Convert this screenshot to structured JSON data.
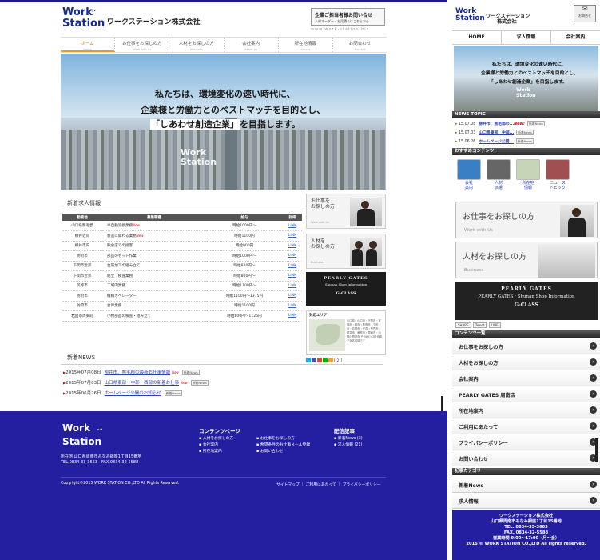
{
  "desktop": {
    "logo": {
      "line1": "Work",
      "line2": "Station"
    },
    "company_name": "ワークステーション株式会社",
    "contact": {
      "title": "企業ご担当者様お問い合せ",
      "sub": "人材オーダー・お見積りはこちらから"
    },
    "url": "www.work-station.biz",
    "nav": [
      {
        "label": "ホーム",
        "en": "Home"
      },
      {
        "label": "お仕事をお探しの方",
        "en": "Work with Us"
      },
      {
        "label": "人材をお探しの方",
        "en": "Business"
      },
      {
        "label": "会社案内",
        "en": "About Us"
      },
      {
        "label": "所在地情報",
        "en": "Access"
      },
      {
        "label": "お問合わせ",
        "en": "Contact"
      }
    ],
    "hero": {
      "line1": "私たちは、環境変化の速い時代に、",
      "line2": "企業様と労働力とのベストマッチを目的とし、",
      "line3_quote": "「しあわせ創造企業」",
      "line3_rest": "を目指します。",
      "watermark1": "Work",
      "watermark2": "Station"
    },
    "jobs": {
      "title": "新着求人情報",
      "headers": [
        "勤務地",
        "募集職種",
        "給与",
        "詳細"
      ],
      "rows": [
        {
          "place": "山口県熊毛郡",
          "type": "半自動溶接業務",
          "new": "New",
          "pay": "時給1000円〜",
          "link": "LINK"
        },
        {
          "place": "柳井近郊",
          "type": "製造に関わる業務",
          "new": "New",
          "pay": "時給1100円",
          "link": "LINK"
        },
        {
          "place": "柳井市内",
          "type": "飲食店での接客",
          "new": "",
          "pay": "時給900円",
          "link": "LINK"
        },
        {
          "place": "防府市",
          "type": "部品のセット作業",
          "new": "",
          "pay": "時給1000円〜",
          "link": "LINK"
        },
        {
          "place": "下関市近郊",
          "type": "金属加工の組み立て",
          "new": "",
          "pay": "時給820円〜",
          "link": "LINK"
        },
        {
          "place": "下関市近郊",
          "type": "組立　検査業務",
          "new": "",
          "pay": "時給800円〜",
          "link": "LINK"
        },
        {
          "place": "美祢市",
          "type": "工場内業務",
          "new": "",
          "pay": "時給1100円〜",
          "link": "LINK"
        },
        {
          "place": "防府市",
          "type": "機械オペレーター",
          "new": "",
          "pay": "時給1100円〜1375円",
          "link": "LINK"
        },
        {
          "place": "防府市",
          "type": "倉庫業務",
          "new": "",
          "pay": "時給1100円",
          "link": "LINK"
        },
        {
          "place": "岩国市周東町",
          "type": "小物部品の検査・組み立て",
          "new": "",
          "pay": "時給800円〜1125円",
          "link": "LINK"
        }
      ]
    },
    "side": {
      "work": {
        "line1": "お仕事を",
        "line2": "お探しの方",
        "en": "Work with Us"
      },
      "business": {
        "line1": "人材を",
        "line2": "お探しの方",
        "en": "Business"
      },
      "pearly": {
        "a": "PEARLY GATES",
        "b": "Shunan Shop Information",
        "c": "G-CLASS"
      },
      "area": {
        "title": "対応エリア",
        "desc": "山口県：山口市・下関市・宇部市・萩市・防府市・下松市・岩国市・光市・長門市・柳井市・美祢市・周南市・山陽小野田市 その他山口県全域で対応可能です"
      },
      "social_count": "2"
    },
    "news": {
      "title": "新着NEWS",
      "items": [
        {
          "date": "2015年07月08日",
          "text": "柳井市、熊毛郡の最新お仕事情報",
          "new": "New",
          "tag": "新着News"
        },
        {
          "date": "2015年07月03日",
          "text": "山口県東部　中部　西部の新着お仕事",
          "new": "New",
          "tag": "新着News"
        },
        {
          "date": "2015年06月26日",
          "text": "ホームページ公開のお知らせ",
          "new": "",
          "tag": "新着News"
        }
      ]
    },
    "footer": {
      "logo1": "Work",
      "logo2": "Station",
      "addr1": "所在地 山口県周南市みなみ銀座1丁目15番地",
      "addr2": "TEL.0834-33-3663　FAX.0834-32-5588",
      "contents_title": "コンテンツページ",
      "contents": [
        "人材をお探しの方",
        "会社案内",
        "所在地案内",
        "お仕事をお探しの方",
        "希望条件のお仕事メール登録",
        "お問い合わせ"
      ],
      "blog_title": "配信記事",
      "blog": [
        "新着News (3)",
        "求人情報 (21)"
      ],
      "copyright": "Copyright©2015 WORK STATION CO.,LTD All Rights Reserved.",
      "links": "サイトマップ ｜ ご利用にあたって ｜ プライバシーポリシー"
    }
  },
  "mobile": {
    "logo": {
      "line1": "Work",
      "line2": "Station"
    },
    "company": "ワークステーション",
    "company2": "株式会社",
    "contact": "お問合せ",
    "nav": [
      "HOME",
      "求人情報",
      "会社案内"
    ],
    "hero": {
      "l1": "私たちは、環境変化の速い時代に、",
      "l2": "企業様と労働力とのベストマッチを目的とし、",
      "l3": "「しあわせ創造企業」を目指します。",
      "wm1": "Work",
      "wm2": "Station"
    },
    "news_topic": "NEWS TOPIC",
    "news": [
      {
        "date": "15.07.08",
        "text": "柳井市、熊毛郡の...",
        "new": "New!",
        "tag": "新着News"
      },
      {
        "date": "15.07.03",
        "text": "山口県東部　中部...",
        "new": "",
        "tag": "新着News"
      },
      {
        "date": "15.06.26",
        "text": "ホームページ公開...",
        "new": "",
        "tag": "新着News"
      }
    ],
    "recommend": "おすすめコンテンツ",
    "icons": [
      {
        "l1": "会社",
        "l2": "案内",
        "color": "#3a7fc4"
      },
      {
        "l1": "人材",
        "l2": "派遣",
        "color": "#666666"
      },
      {
        "l1": "所在地",
        "l2": "情報",
        "color": "#c8d4b8"
      },
      {
        "l1": "ニュース",
        "l2": "トピック",
        "color": "#a05050"
      }
    ],
    "work": {
      "title": "お仕事をお探しの方",
      "en": "Work with Us"
    },
    "business": {
      "title": "人材をお探しの方",
      "en": "Business"
    },
    "pearly": {
      "a": "PEARLY GATES",
      "b": "PEARLY GATES · Shunan Shop Information",
      "c": "G-CLASS"
    },
    "social": [
      "SHARE",
      "Tweet",
      "LINE"
    ],
    "contents_title": "コンテンツ一覧",
    "contents": [
      "お仕事をお探しの方",
      "人材をお探しの方",
      "会社案内",
      "PEARLY GATES 周南店",
      "所在地案内",
      "ご利用にあたって",
      "プライバシーポリシー",
      "お問い合わせ"
    ],
    "category_title": "記事カテゴリ",
    "categories": [
      "新着News",
      "求人情報"
    ],
    "footer": [
      "ワークステーション株式会社",
      "山口県周南市みなみ銀座1丁目15番地",
      "TEL. 0834-33-3663",
      "FAX. 0834-32-5588",
      "営業時間 9:00〜17:00（月〜金）",
      "2015 © WORK STATION CO.,LTD All rights reserved."
    ]
  }
}
